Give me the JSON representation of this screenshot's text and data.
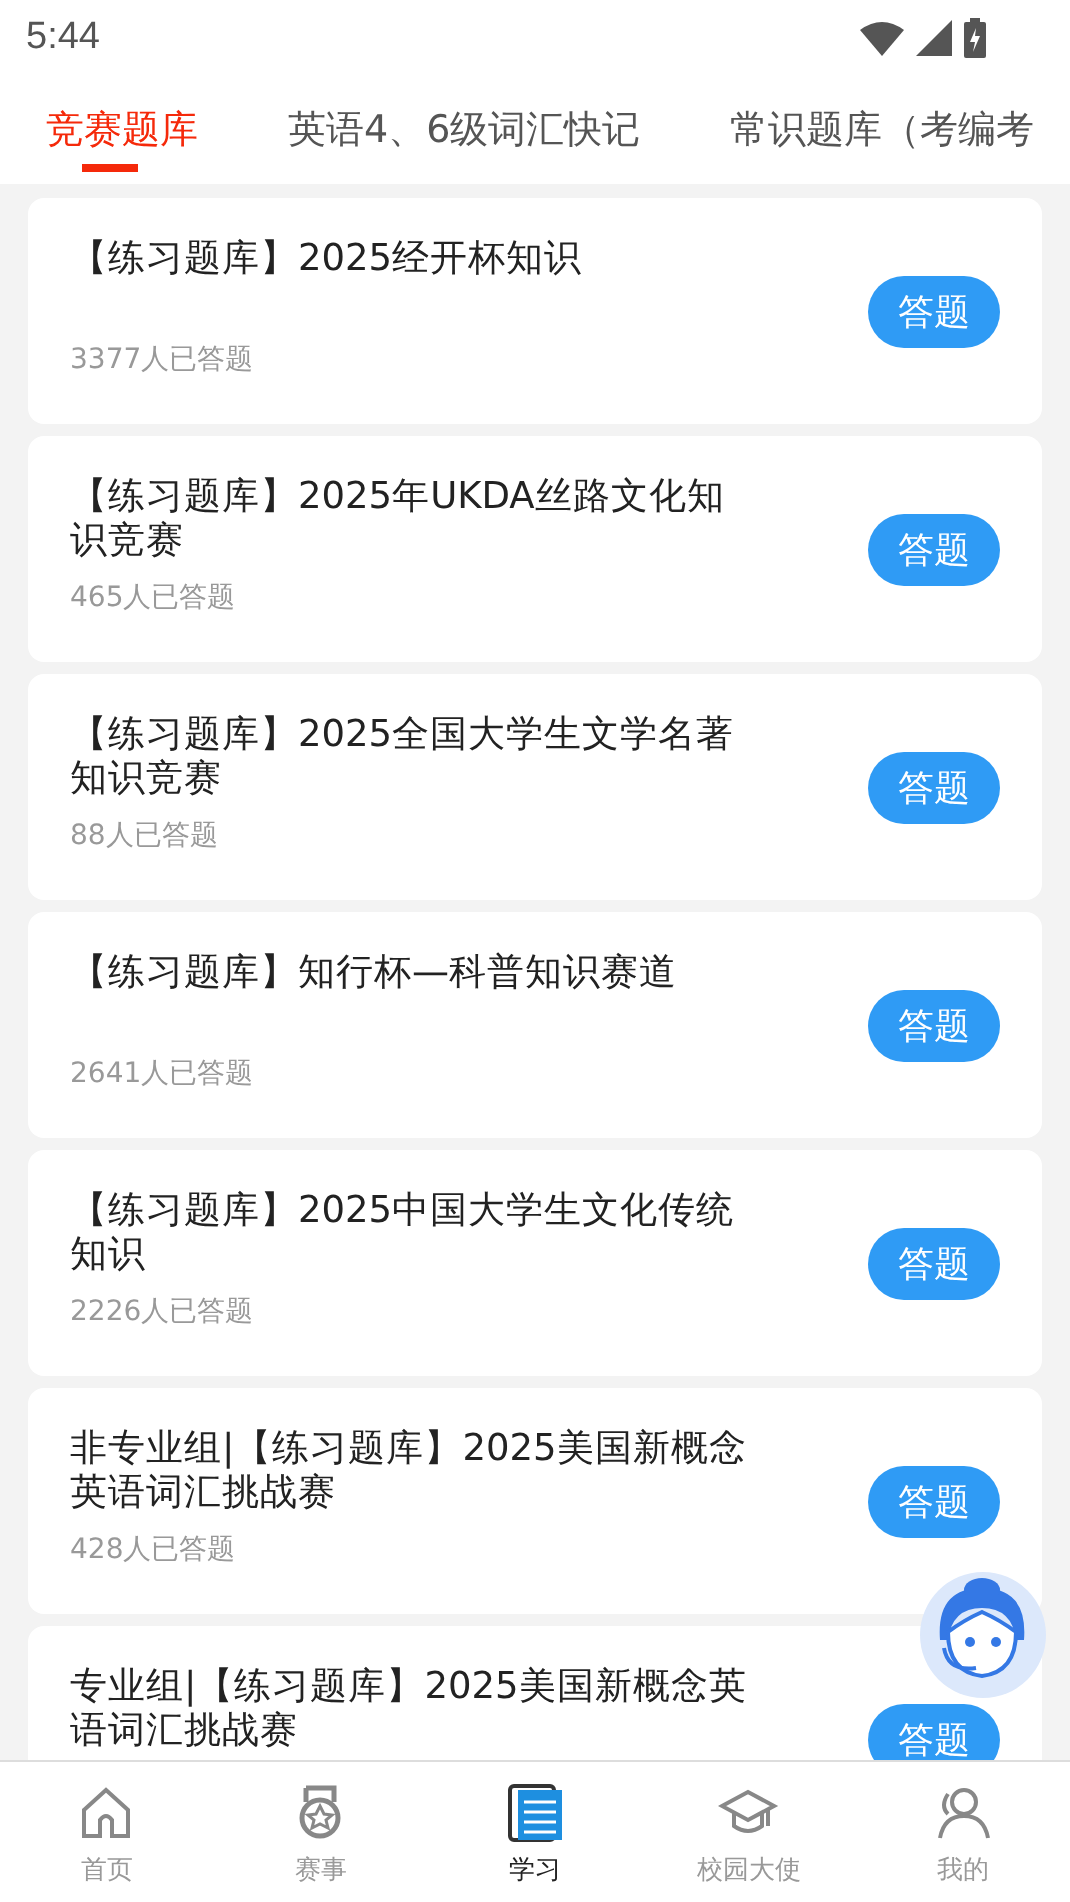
{
  "status_bar": {
    "time": "5:44"
  },
  "tabs": [
    {
      "label": "竞赛题库",
      "selected": true
    },
    {
      "label": "英语4、6级词汇快记",
      "selected": false
    },
    {
      "label": "常识题库（考编考",
      "selected": false
    }
  ],
  "quizzes": [
    {
      "title": "【练习题库】2025经开杯知识",
      "count": "3377人已答题",
      "button": "答题"
    },
    {
      "title": "【练习题库】2025年UKDA丝路文化知识竞赛",
      "count": "465人已答题",
      "button": "答题"
    },
    {
      "title": "【练习题库】2025全国大学生文学名著知识竞赛",
      "count": "88人已答题",
      "button": "答题"
    },
    {
      "title": "【练习题库】知行杯—科普知识赛道",
      "count": "2641人已答题",
      "button": "答题"
    },
    {
      "title": "【练习题库】2025中国大学生文化传统知识",
      "count": "2226人已答题",
      "button": "答题"
    },
    {
      "title": "非专业组|【练习题库】2025美国新概念英语词汇挑战赛",
      "count": "428人已答题",
      "button": "答题"
    },
    {
      "title": "专业组|【练习题库】2025美国新概念英语词汇挑战赛",
      "button": "答题"
    }
  ],
  "bottom_nav": [
    {
      "label": "首页",
      "selected": false
    },
    {
      "label": "赛事",
      "selected": false
    },
    {
      "label": "学习",
      "selected": true
    },
    {
      "label": "校园大使",
      "selected": false
    },
    {
      "label": "我的",
      "selected": false
    }
  ]
}
